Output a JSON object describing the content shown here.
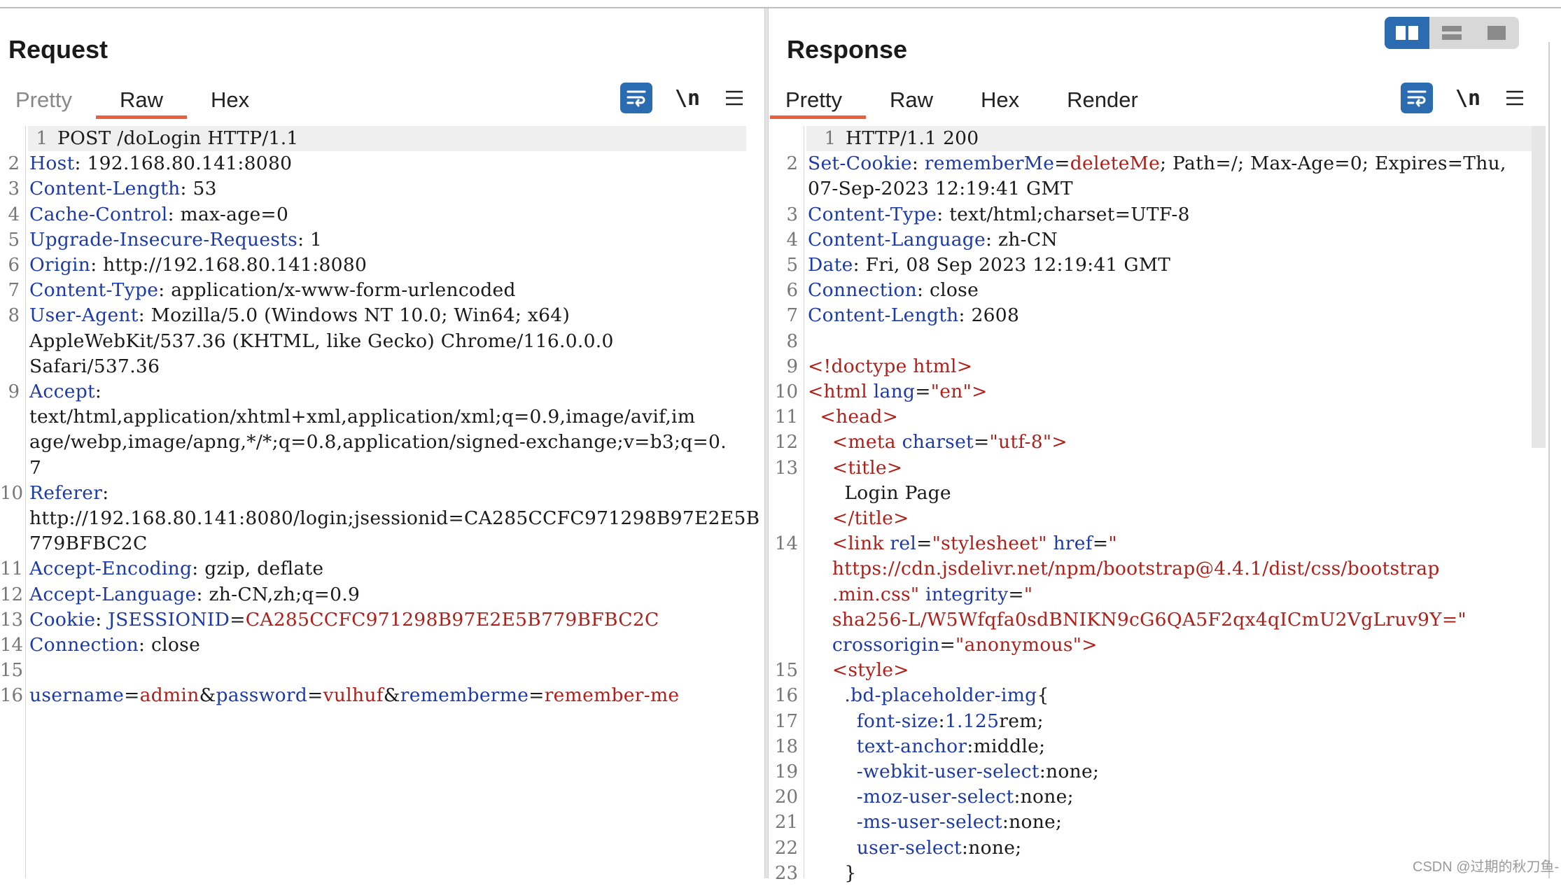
{
  "request": {
    "title": "Request",
    "tabs": [
      "Pretty",
      "Raw",
      "Hex"
    ],
    "active_tab": "Raw",
    "newline_label": "\\n",
    "lines": [
      {
        "n": "1",
        "parts": [
          [
            "v",
            "POST /doLogin HTTP/1.1"
          ]
        ]
      },
      {
        "n": "2",
        "parts": [
          [
            "k",
            "Host"
          ],
          [
            "v",
            ": 192.168.80.141:8080"
          ]
        ]
      },
      {
        "n": "3",
        "parts": [
          [
            "k",
            "Content-Length"
          ],
          [
            "v",
            ": 53"
          ]
        ]
      },
      {
        "n": "4",
        "parts": [
          [
            "k",
            "Cache-Control"
          ],
          [
            "v",
            ": max-age=0"
          ]
        ]
      },
      {
        "n": "5",
        "parts": [
          [
            "k",
            "Upgrade-Insecure-Requests"
          ],
          [
            "v",
            ": 1"
          ]
        ]
      },
      {
        "n": "6",
        "parts": [
          [
            "k",
            "Origin"
          ],
          [
            "v",
            ": http://192.168.80.141:8080"
          ]
        ]
      },
      {
        "n": "7",
        "parts": [
          [
            "k",
            "Content-Type"
          ],
          [
            "v",
            ": application/x-www-form-urlencoded"
          ]
        ]
      },
      {
        "n": "8",
        "parts": [
          [
            "k",
            "User-Agent"
          ],
          [
            "v",
            ": Mozilla/5.0 (Windows NT 10.0; Win64; x64)"
          ]
        ]
      },
      {
        "n": "",
        "parts": [
          [
            "v",
            "AppleWebKit/537.36 (KHTML, like Gecko) Chrome/116.0.0.0"
          ]
        ]
      },
      {
        "n": "",
        "parts": [
          [
            "v",
            "Safari/537.36"
          ]
        ]
      },
      {
        "n": "9",
        "parts": [
          [
            "k",
            "Accept"
          ],
          [
            "v",
            ":"
          ]
        ]
      },
      {
        "n": "",
        "parts": [
          [
            "v",
            "text/html,application/xhtml+xml,application/xml;q=0.9,image/avif,im"
          ]
        ]
      },
      {
        "n": "",
        "parts": [
          [
            "v",
            "age/webp,image/apng,*/*;q=0.8,application/signed-exchange;v=b3;q=0."
          ]
        ]
      },
      {
        "n": "",
        "parts": [
          [
            "v",
            "7"
          ]
        ]
      },
      {
        "n": "10",
        "parts": [
          [
            "k",
            "Referer"
          ],
          [
            "v",
            ":"
          ]
        ]
      },
      {
        "n": "",
        "parts": [
          [
            "v",
            "http://192.168.80.141:8080/login;jsessionid=CA285CCFC971298B97E2E5B"
          ]
        ]
      },
      {
        "n": "",
        "parts": [
          [
            "v",
            "779BFBC2C"
          ]
        ]
      },
      {
        "n": "11",
        "parts": [
          [
            "k",
            "Accept-Encoding"
          ],
          [
            "v",
            ": gzip, deflate"
          ]
        ]
      },
      {
        "n": "12",
        "parts": [
          [
            "k",
            "Accept-Language"
          ],
          [
            "v",
            ": zh-CN,zh;q=0.9"
          ]
        ]
      },
      {
        "n": "13",
        "parts": [
          [
            "k",
            "Cookie"
          ],
          [
            "v",
            ": "
          ],
          [
            "k",
            "JSESSIONID"
          ],
          [
            "v",
            "="
          ],
          [
            "r",
            "CA285CCFC971298B97E2E5B779BFBC2C"
          ]
        ]
      },
      {
        "n": "14",
        "parts": [
          [
            "k",
            "Connection"
          ],
          [
            "v",
            ": close"
          ]
        ]
      },
      {
        "n": "15",
        "parts": []
      },
      {
        "n": "16",
        "parts": [
          [
            "k",
            "username"
          ],
          [
            "v",
            "="
          ],
          [
            "r",
            "admin"
          ],
          [
            "v",
            "&"
          ],
          [
            "k",
            "password"
          ],
          [
            "v",
            "="
          ],
          [
            "r",
            "vulhuf"
          ],
          [
            "v",
            "&"
          ],
          [
            "k",
            "rememberme"
          ],
          [
            "v",
            "="
          ],
          [
            "r",
            "remember-me"
          ]
        ]
      }
    ]
  },
  "response": {
    "title": "Response",
    "tabs": [
      "Pretty",
      "Raw",
      "Hex",
      "Render"
    ],
    "active_tab": "Pretty",
    "newline_label": "\\n",
    "lines": [
      {
        "n": "1",
        "parts": [
          [
            "v",
            "HTTP/1.1 200"
          ]
        ]
      },
      {
        "n": "2",
        "parts": [
          [
            "k",
            "Set-Cookie"
          ],
          [
            "v",
            ": "
          ],
          [
            "k",
            "rememberMe"
          ],
          [
            "v",
            "="
          ],
          [
            "r",
            "deleteMe"
          ],
          [
            "v",
            "; Path=/; Max-Age=0; Expires=Thu,"
          ]
        ]
      },
      {
        "n": "",
        "parts": [
          [
            "v",
            "07-Sep-2023 12:19:41 GMT"
          ]
        ]
      },
      {
        "n": "3",
        "parts": [
          [
            "k",
            "Content-Type"
          ],
          [
            "v",
            ": text/html;charset=UTF-8"
          ]
        ]
      },
      {
        "n": "4",
        "parts": [
          [
            "k",
            "Content-Language"
          ],
          [
            "v",
            ": zh-CN"
          ]
        ]
      },
      {
        "n": "5",
        "parts": [
          [
            "k",
            "Date"
          ],
          [
            "v",
            ": Fri, 08 Sep 2023 12:19:41 GMT"
          ]
        ]
      },
      {
        "n": "6",
        "parts": [
          [
            "k",
            "Connection"
          ],
          [
            "v",
            ": close"
          ]
        ]
      },
      {
        "n": "7",
        "parts": [
          [
            "k",
            "Content-Length"
          ],
          [
            "v",
            ": 2608"
          ]
        ]
      },
      {
        "n": "8",
        "parts": []
      },
      {
        "n": "9",
        "parts": [
          [
            "r",
            "<!doctype html>"
          ]
        ]
      },
      {
        "n": "10",
        "parts": [
          [
            "r",
            "<"
          ],
          [
            "r",
            "html "
          ],
          [
            "a",
            "lang"
          ],
          [
            "v",
            "="
          ],
          [
            "r",
            "\"en\">"
          ]
        ]
      },
      {
        "n": "11",
        "parts": [
          [
            "v",
            "  "
          ],
          [
            "r",
            "<head>"
          ]
        ]
      },
      {
        "n": "12",
        "parts": [
          [
            "v",
            "    "
          ],
          [
            "r",
            "<meta "
          ],
          [
            "a",
            "charset"
          ],
          [
            "v",
            "="
          ],
          [
            "r",
            "\"utf-8\">"
          ]
        ]
      },
      {
        "n": "13",
        "parts": [
          [
            "v",
            "    "
          ],
          [
            "r",
            "<title>"
          ]
        ]
      },
      {
        "n": "",
        "parts": [
          [
            "v",
            "      Login Page"
          ]
        ]
      },
      {
        "n": "",
        "parts": [
          [
            "v",
            "    "
          ],
          [
            "r",
            "</title>"
          ]
        ]
      },
      {
        "n": "14",
        "parts": [
          [
            "v",
            "    "
          ],
          [
            "r",
            "<link "
          ],
          [
            "a",
            "rel"
          ],
          [
            "v",
            "="
          ],
          [
            "r",
            "\"stylesheet\" "
          ],
          [
            "a",
            "href"
          ],
          [
            "v",
            "="
          ],
          [
            "r",
            "\""
          ]
        ]
      },
      {
        "n": "",
        "parts": [
          [
            "v",
            "    "
          ],
          [
            "r",
            "https://cdn.jsdelivr.net/npm/bootstrap@4.4.1/dist/css/bootstrap"
          ]
        ]
      },
      {
        "n": "",
        "parts": [
          [
            "v",
            "    "
          ],
          [
            "r",
            ".min.css\" "
          ],
          [
            "a",
            "integrity"
          ],
          [
            "v",
            "="
          ],
          [
            "r",
            "\""
          ]
        ]
      },
      {
        "n": "",
        "parts": [
          [
            "v",
            "    "
          ],
          [
            "r",
            "sha256-L/W5Wfqfa0sdBNIKN9cG6QA5F2qx4qICmU2VgLruv9Y=\""
          ]
        ]
      },
      {
        "n": "",
        "parts": [
          [
            "v",
            "    "
          ],
          [
            "a",
            "crossorigin"
          ],
          [
            "v",
            "="
          ],
          [
            "r",
            "\"anonymous\">"
          ]
        ]
      },
      {
        "n": "15",
        "parts": [
          [
            "v",
            "    "
          ],
          [
            "r",
            "<style>"
          ]
        ]
      },
      {
        "n": "16",
        "parts": [
          [
            "v",
            "      "
          ],
          [
            "a",
            ".bd-placeholder-img"
          ],
          [
            "v",
            "{"
          ]
        ]
      },
      {
        "n": "17",
        "parts": [
          [
            "v",
            "        "
          ],
          [
            "a",
            "font-size"
          ],
          [
            "v",
            ":"
          ],
          [
            "a",
            "1.125"
          ],
          [
            "v",
            "rem;"
          ]
        ]
      },
      {
        "n": "18",
        "parts": [
          [
            "v",
            "        "
          ],
          [
            "a",
            "text-anchor"
          ],
          [
            "v",
            ":middle;"
          ]
        ]
      },
      {
        "n": "19",
        "parts": [
          [
            "v",
            "        "
          ],
          [
            "a",
            "-webkit-user-select"
          ],
          [
            "v",
            ":none;"
          ]
        ]
      },
      {
        "n": "20",
        "parts": [
          [
            "v",
            "        "
          ],
          [
            "a",
            "-moz-user-select"
          ],
          [
            "v",
            ":none;"
          ]
        ]
      },
      {
        "n": "21",
        "parts": [
          [
            "v",
            "        "
          ],
          [
            "a",
            "-ms-user-select"
          ],
          [
            "v",
            ":none;"
          ]
        ]
      },
      {
        "n": "22",
        "parts": [
          [
            "v",
            "        "
          ],
          [
            "a",
            "user-select"
          ],
          [
            "v",
            ":none;"
          ]
        ]
      },
      {
        "n": "23",
        "parts": [
          [
            "v",
            "      }"
          ]
        ]
      }
    ]
  },
  "watermark": "CSDN @过期的秋刀鱼-",
  "colors": {
    "accent": "#2b6cb0",
    "tab_underline": "#e8603c",
    "key": "#1c3aa8",
    "value_red": "#b0201a"
  },
  "icons": [
    "wrap-lines-icon",
    "menu-icon",
    "layout-side-by-side-icon",
    "layout-stacked-icon",
    "layout-single-icon"
  ]
}
